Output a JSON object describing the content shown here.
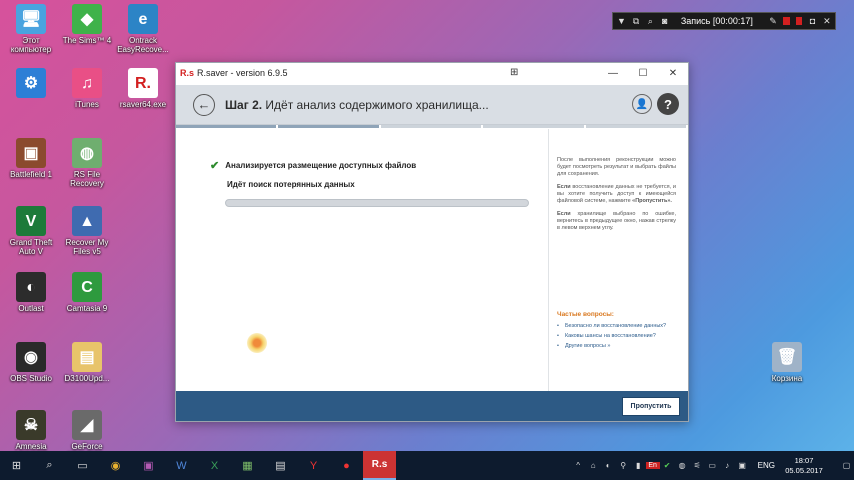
{
  "desktop": {
    "icons": [
      {
        "label": "Этот\nкомпьютер",
        "glyph": "🖥",
        "color": "#4aa3df"
      },
      {
        "label": "The Sims™ 4",
        "glyph": "◆",
        "color": "#3fb24a"
      },
      {
        "label": "Ontrack\nEasyRecove...",
        "glyph": "e",
        "color": "#2c84c6"
      },
      {
        "label": "",
        "glyph": "⚙",
        "color": "#2d7fd6"
      },
      {
        "label": "iTunes",
        "glyph": "♫",
        "color": "#e94f86"
      },
      {
        "label": "rsaver64.exe",
        "glyph": "R.",
        "color": "#ffffff"
      },
      {
        "label": "Battlefield 1",
        "glyph": "▣",
        "color": "#8b4a2e"
      },
      {
        "label": "RS File\nRecovery",
        "glyph": "◍",
        "color": "#6fae6f"
      },
      {
        "label": "Grand Theft\nAuto V",
        "glyph": "V",
        "color": "#1d7a3a"
      },
      {
        "label": "Recover My\nFiles v5",
        "glyph": "▲",
        "color": "#3f6bb0"
      },
      {
        "label": "Outlast",
        "glyph": "◐",
        "color": "#2c2c2c"
      },
      {
        "label": "Camtasia 9",
        "glyph": "C",
        "color": "#2e9a3e"
      },
      {
        "label": "OBS Studio",
        "glyph": "◉",
        "color": "#2a2a2a"
      },
      {
        "label": "D3100Upd...",
        "glyph": "▤",
        "color": "#e8c46a"
      },
      {
        "label": "Amnesia",
        "glyph": "☠",
        "color": "#3a3a2a"
      },
      {
        "label": "GeForce\nExperience",
        "glyph": "◢",
        "color": "#6a6a6a"
      },
      {
        "label": "Корзина",
        "glyph": "🗑",
        "color": "#9fb3c8"
      }
    ]
  },
  "recorder": {
    "label": "Запись [00:00:17]"
  },
  "window": {
    "title_logo": "R.s",
    "title": "R.saver - version 6.9.5",
    "minimize": "—",
    "maximize": "☐",
    "close": "✕",
    "pin": "⊞"
  },
  "header": {
    "step_bold": "Шаг 2.",
    "step_text": "Идёт анализ содержимого хранилища...",
    "back": "←",
    "user": "👤",
    "help": "?"
  },
  "progress_steps": {
    "total": 5,
    "done": 2
  },
  "main": {
    "task_done_label": "Анализируется размещение доступных файлов",
    "task_current_label": "Идёт поиск потерянных данных",
    "progress_fraction": 0.0
  },
  "sidebar": {
    "p1": "После выполнения реконструкции можно будет посмотреть результат и выбрать файлы для сохранения.",
    "p2_bold": "Если",
    "p2": " восстановление данных не требуется, и вы хотите получить доступ к имеющейся файловой системе, нажмите ",
    "p2_button": "«Пропустить».",
    "p3_bold": "Если",
    "p3": " хранилище выбрано по ошибке, вернитесь в предыдущее окно, нажав стрелку в левом верхнем углу.",
    "faq_title": "Частые вопросы:",
    "faq": [
      "Безопасно ли восстановление данных?",
      "Каковы шансы на восстановление?",
      "Другие вопросы »"
    ]
  },
  "footer": {
    "skip_label": "Пропустить"
  },
  "taskbar": {
    "lang": "ENG",
    "time": "18:07",
    "date": "05.05.2017",
    "tray_en": "En"
  }
}
